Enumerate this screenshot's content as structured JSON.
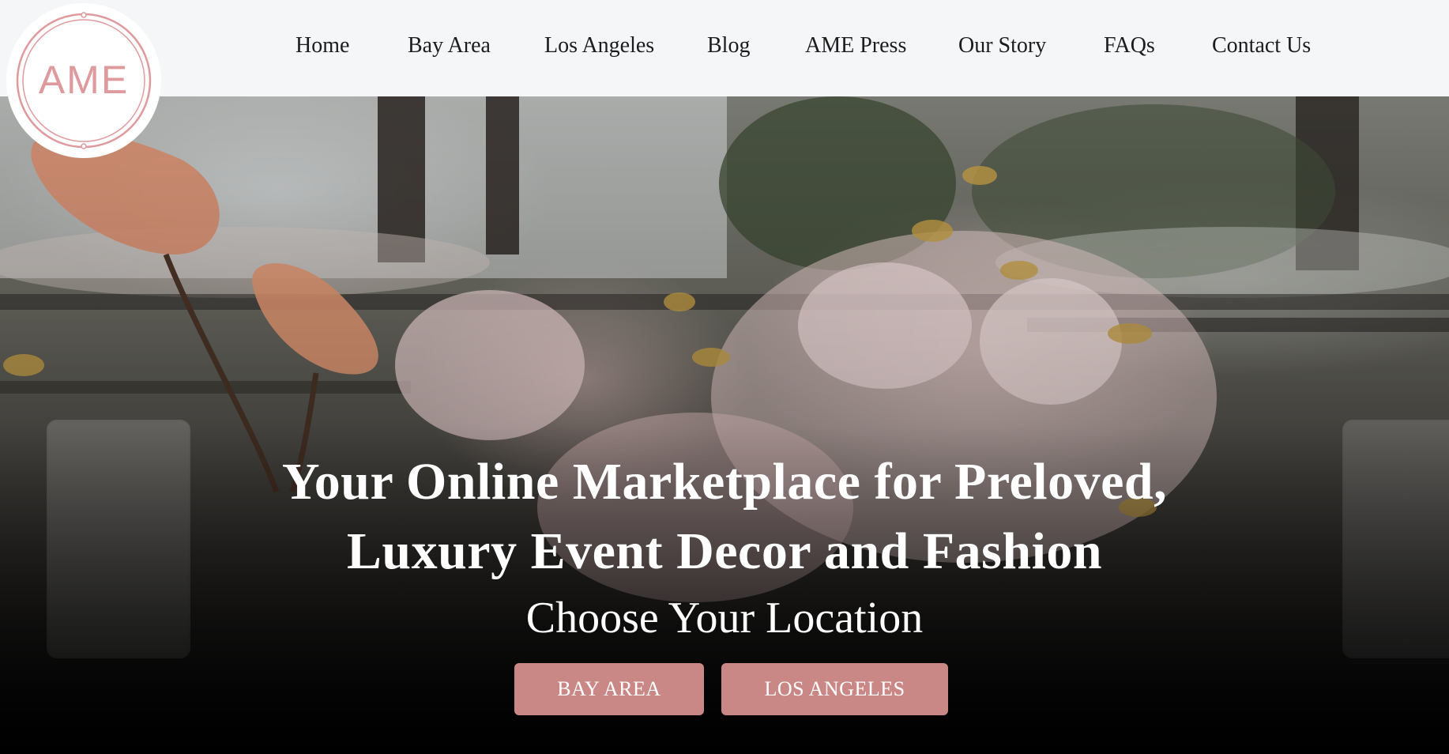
{
  "brand": {
    "logo_text": "AME",
    "accent_color": "#df9a9d"
  },
  "nav": {
    "items": [
      {
        "label": "Home"
      },
      {
        "label": "Bay Area"
      },
      {
        "label": "Los Angeles"
      },
      {
        "label": "Blog"
      },
      {
        "label": "AME Press"
      },
      {
        "label": "Our Story"
      },
      {
        "label": "FAQs"
      },
      {
        "label": "Contact Us"
      }
    ]
  },
  "hero": {
    "title_line1": "Your Online Marketplace for Preloved,",
    "title_line2": "Luxury Event Decor and Fashion",
    "subtitle": "Choose Your Location",
    "buttons": [
      {
        "label": "BAY AREA"
      },
      {
        "label": "LOS ANGELES"
      }
    ],
    "button_color": "#c98886"
  }
}
